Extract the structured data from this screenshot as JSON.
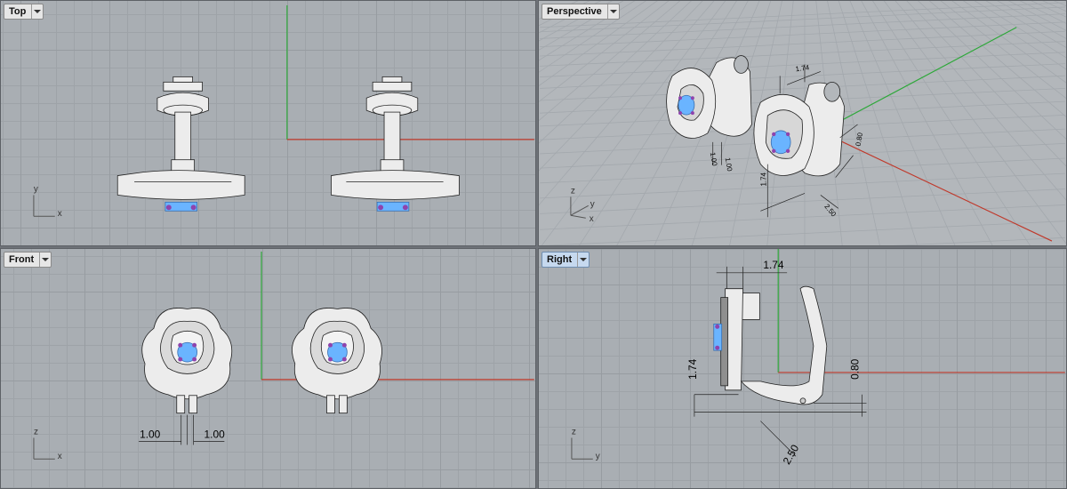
{
  "viewports": {
    "top": {
      "label": "Top"
    },
    "perspective": {
      "label": "Perspective"
    },
    "front": {
      "label": "Front"
    },
    "right": {
      "label": "Right"
    }
  },
  "axes": {
    "top": {
      "v": "y",
      "h": "x"
    },
    "perspective": {
      "v": "z",
      "h1": "y",
      "h2": "x"
    },
    "front": {
      "v": "z",
      "h": "x"
    },
    "right": {
      "v": "z",
      "h": "y"
    }
  },
  "dimensions": {
    "perspective": {
      "top": "1.74",
      "left": "1.74",
      "right": "0.80",
      "bottom": "2.50",
      "small_a": "1.00",
      "small_b": "1.00"
    },
    "front": {
      "left": "1.00",
      "right": "1.00"
    },
    "right": {
      "top": "1.74",
      "left": "1.74",
      "right": "0.80",
      "diag": "2.50"
    }
  },
  "colors": {
    "x_axis": "#c0392b",
    "y_axis": "#2ea83a",
    "gem": "#6ab4ff",
    "prong": "#8e44ad",
    "metal": "#e8e8e8",
    "active_tab": "#c6d9ef"
  }
}
